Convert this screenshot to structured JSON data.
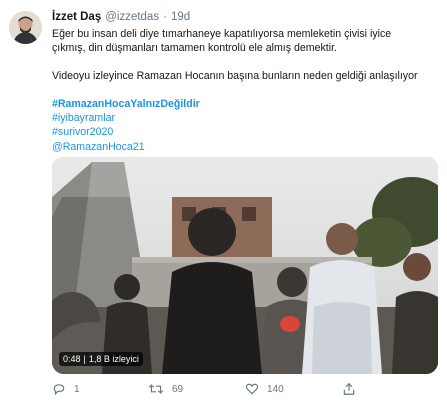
{
  "tweet": {
    "author_name": "İzzet Daş",
    "author_handle": "@izzetdas",
    "separator": "·",
    "time": "19d",
    "text_line1": "Eğer bu insan deli diye tımarhaneye kapatılıyorsa memleketin çivisi iyice",
    "text_line2": "çıkmış, din düşmanları tamamen kontrolü ele almış demektir.",
    "text_line3": "Videoyu izleyince Ramazan Hocanın başına bunların neden geldiği anlaşılıyor",
    "hashtags": [
      "#RamazanHocaYalnızDeğildir",
      "#iyibayramlar",
      "#surivor2020",
      "@RamazanHoca21"
    ]
  },
  "video": {
    "duration": "0:48",
    "separator": "|",
    "views": "1,8 B izleyici"
  },
  "actions": {
    "reply_count": "1",
    "retweet_count": "69",
    "like_count": "140",
    "icons": [
      "reply-icon",
      "retweet-icon",
      "like-icon",
      "share-icon"
    ]
  },
  "colors": {
    "link": "#1b95e0",
    "secondary": "#657786",
    "text": "#14171a"
  }
}
